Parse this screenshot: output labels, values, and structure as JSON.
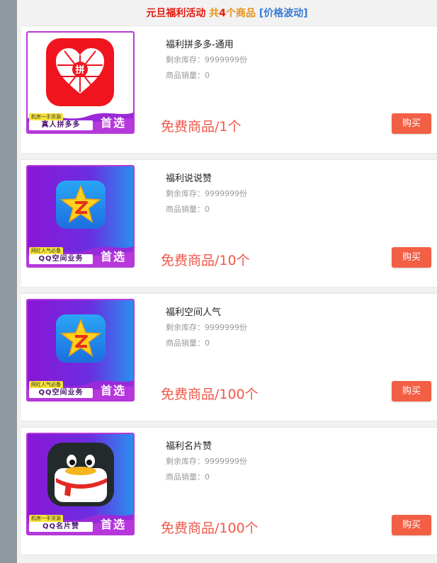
{
  "header": {
    "event": "元旦福利活动",
    "count_prefix": "共",
    "count": "4",
    "count_suffix": "个商品",
    "note": "[价格波动]"
  },
  "products": [
    {
      "title": "福利拼多多-通用",
      "stock": "剩余库存：9999999份",
      "sales": "商品销量：0",
      "price": "免费商品/1个",
      "buy_label": "购买",
      "thumb": {
        "icon": "pinduoduo-logo-icon",
        "logo_char": "拼",
        "banner_tag": "机房一手货源",
        "banner_name": "真人拼多多",
        "banner_pick": "首选"
      }
    },
    {
      "title": "福利说说赞",
      "stock": "剩余库存：9999999份",
      "sales": "商品销量：0",
      "price": "免费商品/10个",
      "buy_label": "购买",
      "thumb": {
        "icon": "qzone-star-icon",
        "banner_tag": "网红人气必备",
        "banner_name": "QQ空间业务",
        "banner_pick": "首选"
      }
    },
    {
      "title": "福利空间人气",
      "stock": "剩余库存：9999999份",
      "sales": "商品销量：0",
      "price": "免费商品/100个",
      "buy_label": "购买",
      "thumb": {
        "icon": "qzone-star-icon",
        "banner_tag": "网红人气必备",
        "banner_name": "QQ空间业务",
        "banner_pick": "首选"
      }
    },
    {
      "title": "福利名片赞",
      "stock": "剩余库存：9999999份",
      "sales": "商品销量：0",
      "price": "免费商品/100个",
      "buy_label": "购买",
      "thumb": {
        "icon": "qq-penguin-icon",
        "banner_tag": "机房一手货源",
        "banner_name": "QQ名片赞",
        "banner_pick": "首选"
      }
    }
  ],
  "colors": {
    "accent_red": "#e8190d",
    "accent_orange": "#e5941a",
    "accent_blue": "#3a7bd5",
    "price_red": "#f2574a",
    "buy_button": "#f25f44"
  }
}
